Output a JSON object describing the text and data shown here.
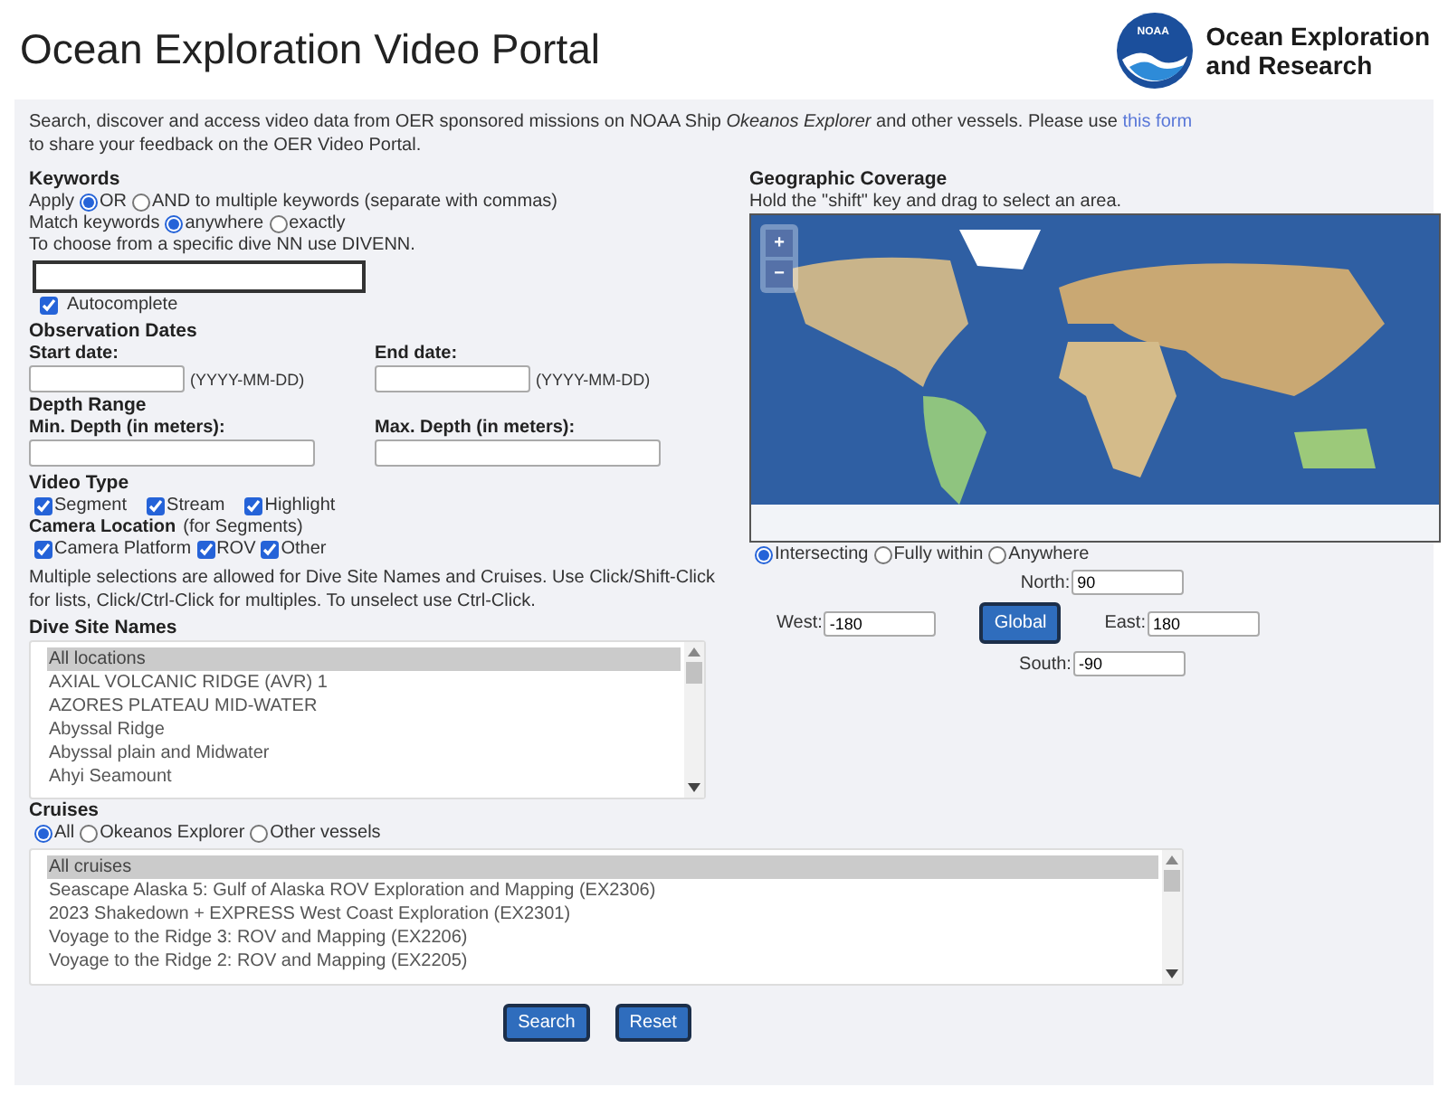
{
  "header": {
    "title": "Ocean Exploration Video Portal",
    "logo_badge": "NOAA",
    "logo_lines": [
      "Ocean Exploration",
      "and Research"
    ]
  },
  "intro": {
    "text": "Search, discover and access video data from OER sponsored missions on NOAA Ship *Okeanos Explorer* and other vessels. Please use",
    "link": "this form",
    "text_after": "to share your feedback on the OER Video Portal."
  },
  "keywords": {
    "heading": "Keywords",
    "apply_label": "Apply",
    "apply_options": [
      {
        "label": "OR",
        "selected": true
      },
      {
        "label": "AND to multiple keywords (separate with commas)",
        "selected": false
      }
    ],
    "match_label": "Match keywords",
    "match_options": [
      {
        "label": "anywhere",
        "selected": true
      },
      {
        "label": "exactly",
        "selected": false
      }
    ],
    "hint": "To choose from a specific dive NN use DIVENN.",
    "autocomplete": {
      "label": "Autocomplete",
      "checked": true
    }
  },
  "dates": {
    "heading": "Observation Dates",
    "start_label": "Start date:",
    "end_label": "End date:",
    "start_format": "(YYYY-MM-DD)",
    "end_format": "(YYYY-MM-DD)"
  },
  "depth": {
    "heading": "Depth Range",
    "min_label": "Min. Depth (in meters):",
    "max_label": "Max. Depth (in meters):"
  },
  "video_type": {
    "heading": "Video Type",
    "options": [
      {
        "label": "Segment",
        "checked": true
      },
      {
        "label": "Stream",
        "checked": true
      },
      {
        "label": "Highlight",
        "checked": true
      }
    ]
  },
  "camera": {
    "heading": "Camera Location",
    "note": "(for Segments)",
    "options": [
      {
        "label": "Camera Platform",
        "checked": true
      },
      {
        "label": "ROV",
        "checked": true
      },
      {
        "label": "Other",
        "checked": true
      }
    ]
  },
  "multi_note": "Multiple selections are allowed for Dive Site Names and Cruises. Use Click/Shift-Click for lists, Click/Ctrl-Click for multiples. To unselect use Ctrl-Click.",
  "dive_sites": {
    "heading": "Dive Site Names",
    "items": [
      {
        "label": "All locations",
        "selected": true
      },
      {
        "label": "AXIAL VOLCANIC RIDGE (AVR) 1",
        "selected": false
      },
      {
        "label": "AZORES PLATEAU MID-WATER",
        "selected": false
      },
      {
        "label": "Abyssal Ridge",
        "selected": false
      },
      {
        "label": "Abyssal plain and Midwater",
        "selected": false
      },
      {
        "label": "Ahyi Seamount",
        "selected": false
      }
    ]
  },
  "geo": {
    "heading": "Geographic Coverage",
    "hint": "Hold the \"shift\" key and drag to select an area.",
    "zoom_in": "+",
    "zoom_out": "−",
    "modes": [
      {
        "label": "Intersecting",
        "selected": true
      },
      {
        "label": "Fully within",
        "selected": false
      },
      {
        "label": "Anywhere",
        "selected": false
      }
    ],
    "north": {
      "label": "North:",
      "value": "90"
    },
    "west": {
      "label": "West:",
      "value": "-180"
    },
    "east": {
      "label": "East:",
      "value": "180"
    },
    "south": {
      "label": "South:",
      "value": "-90"
    },
    "global_button": "Global"
  },
  "cruises": {
    "heading": "Cruises",
    "filters": [
      {
        "label": "All",
        "selected": true
      },
      {
        "label": "Okeanos Explorer",
        "selected": false
      },
      {
        "label": "Other vessels",
        "selected": false
      }
    ],
    "items": [
      {
        "label": "All cruises",
        "selected": true
      },
      {
        "label": "Seascape Alaska 5: Gulf of Alaska ROV Exploration and Mapping (EX2306)",
        "selected": false
      },
      {
        "label": "2023 Shakedown + EXPRESS West Coast Exploration (EX2301)",
        "selected": false
      },
      {
        "label": "Voyage to the Ridge 3: ROV and Mapping (EX2206)",
        "selected": false
      },
      {
        "label": "Voyage to the Ridge 2: ROV and Mapping (EX2205)",
        "selected": false
      }
    ]
  },
  "buttons": [
    {
      "label": "Search"
    },
    {
      "label": "Reset"
    }
  ]
}
